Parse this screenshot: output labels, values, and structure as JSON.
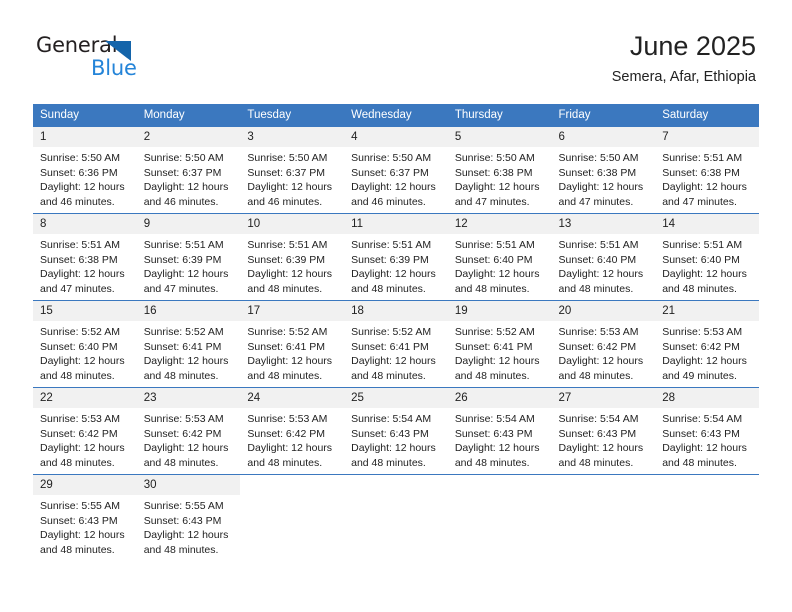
{
  "brand": {
    "name_part1": "General",
    "name_part2": "Blue",
    "triangle_icon": "triangle-icon"
  },
  "header": {
    "title": "June 2025",
    "subtitle": "Semera, Afar, Ethiopia"
  },
  "colors": {
    "header_blue": "#3b78bf",
    "logo_blue": "#2484d8",
    "logo_dark": "#231f20",
    "daynum_bg": "#f1f1f1",
    "text": "#222222"
  },
  "labels": {
    "sunrise_prefix": "Sunrise:",
    "sunset_prefix": "Sunset:",
    "daylight_prefix": "Daylight:"
  },
  "weekdays": [
    "Sunday",
    "Monday",
    "Tuesday",
    "Wednesday",
    "Thursday",
    "Friday",
    "Saturday"
  ],
  "weeks": [
    [
      {
        "day": "1",
        "sunrise": "Sunrise: 5:50 AM",
        "sunset": "Sunset: 6:36 PM",
        "daylight": "Daylight: 12 hours and 46 minutes."
      },
      {
        "day": "2",
        "sunrise": "Sunrise: 5:50 AM",
        "sunset": "Sunset: 6:37 PM",
        "daylight": "Daylight: 12 hours and 46 minutes."
      },
      {
        "day": "3",
        "sunrise": "Sunrise: 5:50 AM",
        "sunset": "Sunset: 6:37 PM",
        "daylight": "Daylight: 12 hours and 46 minutes."
      },
      {
        "day": "4",
        "sunrise": "Sunrise: 5:50 AM",
        "sunset": "Sunset: 6:37 PM",
        "daylight": "Daylight: 12 hours and 46 minutes."
      },
      {
        "day": "5",
        "sunrise": "Sunrise: 5:50 AM",
        "sunset": "Sunset: 6:38 PM",
        "daylight": "Daylight: 12 hours and 47 minutes."
      },
      {
        "day": "6",
        "sunrise": "Sunrise: 5:50 AM",
        "sunset": "Sunset: 6:38 PM",
        "daylight": "Daylight: 12 hours and 47 minutes."
      },
      {
        "day": "7",
        "sunrise": "Sunrise: 5:51 AM",
        "sunset": "Sunset: 6:38 PM",
        "daylight": "Daylight: 12 hours and 47 minutes."
      }
    ],
    [
      {
        "day": "8",
        "sunrise": "Sunrise: 5:51 AM",
        "sunset": "Sunset: 6:38 PM",
        "daylight": "Daylight: 12 hours and 47 minutes."
      },
      {
        "day": "9",
        "sunrise": "Sunrise: 5:51 AM",
        "sunset": "Sunset: 6:39 PM",
        "daylight": "Daylight: 12 hours and 47 minutes."
      },
      {
        "day": "10",
        "sunrise": "Sunrise: 5:51 AM",
        "sunset": "Sunset: 6:39 PM",
        "daylight": "Daylight: 12 hours and 48 minutes."
      },
      {
        "day": "11",
        "sunrise": "Sunrise: 5:51 AM",
        "sunset": "Sunset: 6:39 PM",
        "daylight": "Daylight: 12 hours and 48 minutes."
      },
      {
        "day": "12",
        "sunrise": "Sunrise: 5:51 AM",
        "sunset": "Sunset: 6:40 PM",
        "daylight": "Daylight: 12 hours and 48 minutes."
      },
      {
        "day": "13",
        "sunrise": "Sunrise: 5:51 AM",
        "sunset": "Sunset: 6:40 PM",
        "daylight": "Daylight: 12 hours and 48 minutes."
      },
      {
        "day": "14",
        "sunrise": "Sunrise: 5:51 AM",
        "sunset": "Sunset: 6:40 PM",
        "daylight": "Daylight: 12 hours and 48 minutes."
      }
    ],
    [
      {
        "day": "15",
        "sunrise": "Sunrise: 5:52 AM",
        "sunset": "Sunset: 6:40 PM",
        "daylight": "Daylight: 12 hours and 48 minutes."
      },
      {
        "day": "16",
        "sunrise": "Sunrise: 5:52 AM",
        "sunset": "Sunset: 6:41 PM",
        "daylight": "Daylight: 12 hours and 48 minutes."
      },
      {
        "day": "17",
        "sunrise": "Sunrise: 5:52 AM",
        "sunset": "Sunset: 6:41 PM",
        "daylight": "Daylight: 12 hours and 48 minutes."
      },
      {
        "day": "18",
        "sunrise": "Sunrise: 5:52 AM",
        "sunset": "Sunset: 6:41 PM",
        "daylight": "Daylight: 12 hours and 48 minutes."
      },
      {
        "day": "19",
        "sunrise": "Sunrise: 5:52 AM",
        "sunset": "Sunset: 6:41 PM",
        "daylight": "Daylight: 12 hours and 48 minutes."
      },
      {
        "day": "20",
        "sunrise": "Sunrise: 5:53 AM",
        "sunset": "Sunset: 6:42 PM",
        "daylight": "Daylight: 12 hours and 48 minutes."
      },
      {
        "day": "21",
        "sunrise": "Sunrise: 5:53 AM",
        "sunset": "Sunset: 6:42 PM",
        "daylight": "Daylight: 12 hours and 49 minutes."
      }
    ],
    [
      {
        "day": "22",
        "sunrise": "Sunrise: 5:53 AM",
        "sunset": "Sunset: 6:42 PM",
        "daylight": "Daylight: 12 hours and 48 minutes."
      },
      {
        "day": "23",
        "sunrise": "Sunrise: 5:53 AM",
        "sunset": "Sunset: 6:42 PM",
        "daylight": "Daylight: 12 hours and 48 minutes."
      },
      {
        "day": "24",
        "sunrise": "Sunrise: 5:53 AM",
        "sunset": "Sunset: 6:42 PM",
        "daylight": "Daylight: 12 hours and 48 minutes."
      },
      {
        "day": "25",
        "sunrise": "Sunrise: 5:54 AM",
        "sunset": "Sunset: 6:43 PM",
        "daylight": "Daylight: 12 hours and 48 minutes."
      },
      {
        "day": "26",
        "sunrise": "Sunrise: 5:54 AM",
        "sunset": "Sunset: 6:43 PM",
        "daylight": "Daylight: 12 hours and 48 minutes."
      },
      {
        "day": "27",
        "sunrise": "Sunrise: 5:54 AM",
        "sunset": "Sunset: 6:43 PM",
        "daylight": "Daylight: 12 hours and 48 minutes."
      },
      {
        "day": "28",
        "sunrise": "Sunrise: 5:54 AM",
        "sunset": "Sunset: 6:43 PM",
        "daylight": "Daylight: 12 hours and 48 minutes."
      }
    ],
    [
      {
        "day": "29",
        "sunrise": "Sunrise: 5:55 AM",
        "sunset": "Sunset: 6:43 PM",
        "daylight": "Daylight: 12 hours and 48 minutes."
      },
      {
        "day": "30",
        "sunrise": "Sunrise: 5:55 AM",
        "sunset": "Sunset: 6:43 PM",
        "daylight": "Daylight: 12 hours and 48 minutes."
      },
      {
        "day": "",
        "sunrise": "",
        "sunset": "",
        "daylight": ""
      },
      {
        "day": "",
        "sunrise": "",
        "sunset": "",
        "daylight": ""
      },
      {
        "day": "",
        "sunrise": "",
        "sunset": "",
        "daylight": ""
      },
      {
        "day": "",
        "sunrise": "",
        "sunset": "",
        "daylight": ""
      },
      {
        "day": "",
        "sunrise": "",
        "sunset": "",
        "daylight": ""
      }
    ]
  ]
}
